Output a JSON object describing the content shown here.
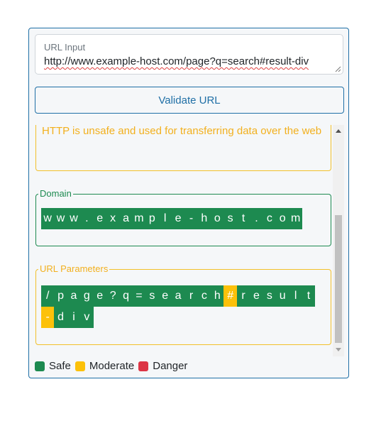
{
  "url_input": {
    "label": "URL Input",
    "value": "http://www.example-host.com/page?q=search#result-div"
  },
  "validate_button": {
    "label": "Validate URL"
  },
  "protocol_section": {
    "message": "HTTP is unsafe and used for transferring data over the web"
  },
  "domain_section": {
    "label": "Domain",
    "chars": [
      {
        "c": "w",
        "level": "safe"
      },
      {
        "c": "w",
        "level": "safe"
      },
      {
        "c": "w",
        "level": "safe"
      },
      {
        "c": ".",
        "level": "safe"
      },
      {
        "c": "e",
        "level": "safe"
      },
      {
        "c": "x",
        "level": "safe"
      },
      {
        "c": "a",
        "level": "safe"
      },
      {
        "c": "m",
        "level": "safe"
      },
      {
        "c": "p",
        "level": "safe"
      },
      {
        "c": "l",
        "level": "safe"
      },
      {
        "c": "e",
        "level": "safe"
      },
      {
        "c": "-",
        "level": "safe"
      },
      {
        "c": "h",
        "level": "safe"
      },
      {
        "c": "o",
        "level": "safe"
      },
      {
        "c": "s",
        "level": "safe"
      },
      {
        "c": "t",
        "level": "safe"
      },
      {
        "c": ".",
        "level": "safe"
      },
      {
        "c": "c",
        "level": "safe"
      },
      {
        "c": "o",
        "level": "safe"
      },
      {
        "c": "m",
        "level": "safe"
      }
    ]
  },
  "params_section": {
    "label": "URL Parameters",
    "chars": [
      {
        "c": "/",
        "level": "safe"
      },
      {
        "c": "p",
        "level": "safe"
      },
      {
        "c": "a",
        "level": "safe"
      },
      {
        "c": "g",
        "level": "safe"
      },
      {
        "c": "e",
        "level": "safe"
      },
      {
        "c": "?",
        "level": "safe"
      },
      {
        "c": "q",
        "level": "safe"
      },
      {
        "c": "=",
        "level": "safe"
      },
      {
        "c": "s",
        "level": "safe"
      },
      {
        "c": "e",
        "level": "safe"
      },
      {
        "c": "a",
        "level": "safe"
      },
      {
        "c": "r",
        "level": "safe"
      },
      {
        "c": "c",
        "level": "safe"
      },
      {
        "c": "h",
        "level": "safe"
      },
      {
        "c": "#",
        "level": "moderate"
      },
      {
        "c": "r",
        "level": "safe"
      },
      {
        "c": "e",
        "level": "safe"
      },
      {
        "c": "s",
        "level": "safe"
      },
      {
        "c": "u",
        "level": "safe"
      },
      {
        "c": "l",
        "level": "safe"
      },
      {
        "c": "t",
        "level": "safe"
      },
      {
        "c": "-",
        "level": "moderate"
      },
      {
        "c": "d",
        "level": "safe"
      },
      {
        "c": "i",
        "level": "safe"
      },
      {
        "c": "v",
        "level": "safe"
      }
    ]
  },
  "legend": [
    {
      "label": "Safe",
      "level": "safe",
      "color": "#1d8a50"
    },
    {
      "label": "Moderate",
      "level": "moderate",
      "color": "#fcc10a"
    },
    {
      "label": "Danger",
      "level": "danger",
      "color": "#dc3545"
    }
  ],
  "colors": {
    "primary": "#1f6fa6",
    "safe": "#1d8a50",
    "moderate": "#fcc10a",
    "danger": "#dc3545",
    "warning_text": "#f2b01e"
  }
}
